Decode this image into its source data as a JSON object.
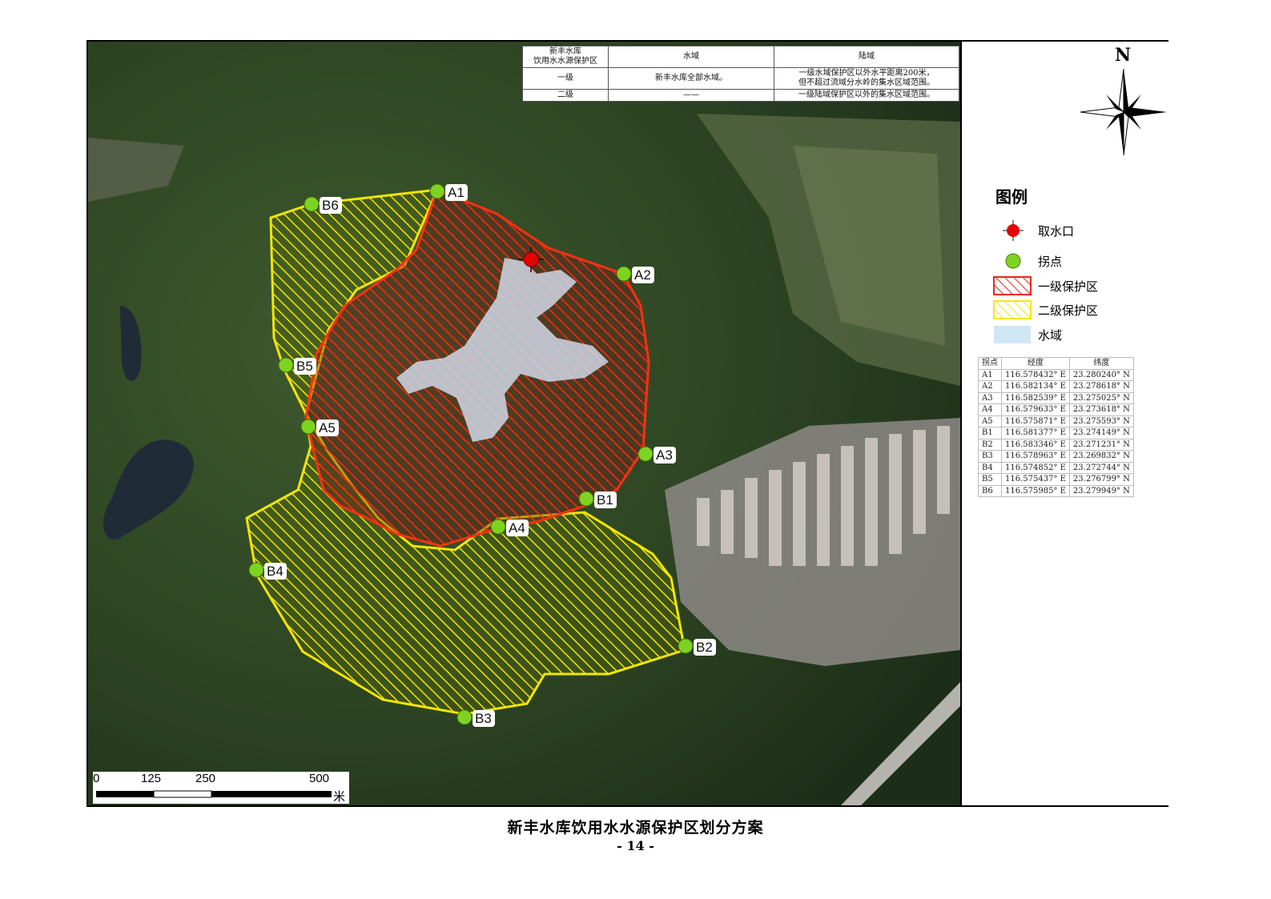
{
  "info_table": {
    "header": [
      "新丰水库\n饮用水水源保护区",
      "水域",
      "陆域"
    ],
    "rows": [
      [
        "一级",
        "新丰水库全部水域。",
        "一级水域保护区以外水平距离200米，\n但不超过流域分水岭的集水区域范围。"
      ],
      [
        "二级",
        "——",
        "一级陆域保护区以外的集水区域范围。"
      ]
    ]
  },
  "north_label": "N",
  "legend": {
    "title": "图例",
    "items": [
      {
        "label": "取水口",
        "icon": "water-intake-icon",
        "color": "#e60000"
      },
      {
        "label": "拐点",
        "icon": "turning-point-icon",
        "color": "#7ed321"
      },
      {
        "label": "一级保护区",
        "icon": "primary-zone-hatch-icon",
        "color": "#e62a14"
      },
      {
        "label": "二级保护区",
        "icon": "secondary-zone-hatch-icon",
        "color": "#f5e61e"
      },
      {
        "label": "水域",
        "icon": "water-area-icon",
        "color": "#cfe6f5"
      }
    ]
  },
  "coordinates": {
    "headers": [
      "拐点",
      "经度",
      "纬度"
    ],
    "rows": [
      [
        "A1",
        "116.578432° E",
        "23.280240° N"
      ],
      [
        "A2",
        "116.582134° E",
        "23.278618° N"
      ],
      [
        "A3",
        "116.582539° E",
        "23.275025° N"
      ],
      [
        "A4",
        "116.579633° E",
        "23.273618° N"
      ],
      [
        "A5",
        "116.575871° E",
        "23.275593° N"
      ],
      [
        "B1",
        "116.581377° E",
        "23.274149° N"
      ],
      [
        "B2",
        "116.583346° E",
        "23.271231° N"
      ],
      [
        "B3",
        "116.578963° E",
        "23.269832° N"
      ],
      [
        "B4",
        "116.574852° E",
        "23.272744° N"
      ],
      [
        "B5",
        "116.575437° E",
        "23.276799° N"
      ],
      [
        "B6",
        "116.575985° E",
        "23.279949° N"
      ]
    ]
  },
  "scale": {
    "ticks": [
      "0",
      "125",
      "250",
      "500"
    ],
    "unit": "米"
  },
  "points": [
    "A1",
    "A2",
    "A3",
    "A4",
    "A5",
    "B1",
    "B2",
    "B3",
    "B4",
    "B5",
    "B6"
  ],
  "colors": {
    "primary_outline": "#e62a14",
    "secondary_outline": "#f2e600",
    "point_fill": "#7ed321",
    "water": "#cfd8e6"
  },
  "page_title": "新丰水库饮用水水源保护区划分方案",
  "page_number": "- 14 -"
}
